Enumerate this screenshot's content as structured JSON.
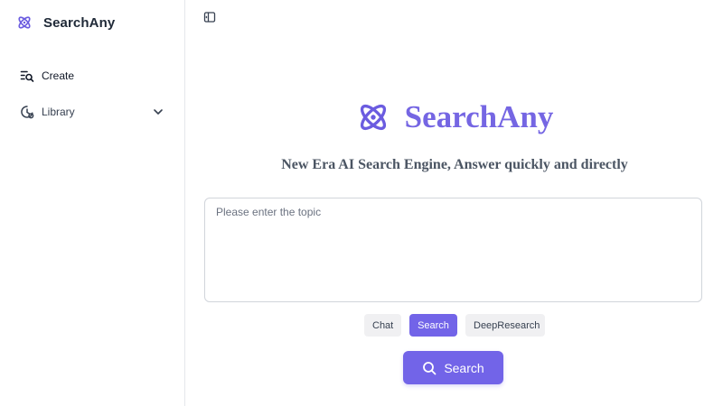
{
  "app": {
    "name": "SearchAny",
    "accent_color": "#7264e8",
    "logo_icon": "atom-icon"
  },
  "sidebar": {
    "items": [
      {
        "label": "Create",
        "icon": "create-search-icon"
      },
      {
        "label": "Library",
        "icon": "clock-library-icon",
        "expand_icon": "chevron-down-icon"
      }
    ]
  },
  "header": {
    "collapse_icon": "sidebar-toggle-icon"
  },
  "main": {
    "title": "SearchAny",
    "tagline": "New Era AI Search Engine, Answer quickly and directly",
    "input": {
      "value": "",
      "placeholder": "Please enter the topic"
    },
    "modes": [
      {
        "label": "Chat",
        "active": false
      },
      {
        "label": "Search",
        "active": true
      },
      {
        "label": "DeepResearch",
        "active": false
      }
    ],
    "submit": {
      "label": "Search",
      "icon": "search-icon"
    }
  }
}
